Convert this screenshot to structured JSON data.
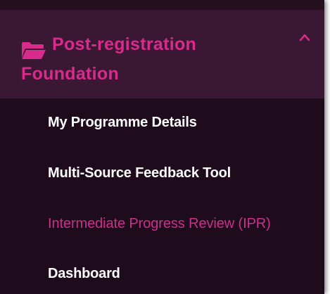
{
  "colors": {
    "panel_background": "#1e0b1b",
    "header_background": "#3a1733",
    "accent": "#d92b8c",
    "active_link": "#cc2f8c",
    "link": "#ffffff"
  },
  "section": {
    "icon": "folder-open-icon",
    "title": "Post-registration Foundation",
    "toggle_icon": "chevron-up-icon"
  },
  "nav": {
    "items": [
      {
        "label": "My Programme Details",
        "active": false
      },
      {
        "label": "Multi-Source Feedback Tool",
        "active": false
      },
      {
        "label": "Intermediate Progress Review (IPR)",
        "active": true
      },
      {
        "label": "Dashboard",
        "active": false
      }
    ]
  }
}
